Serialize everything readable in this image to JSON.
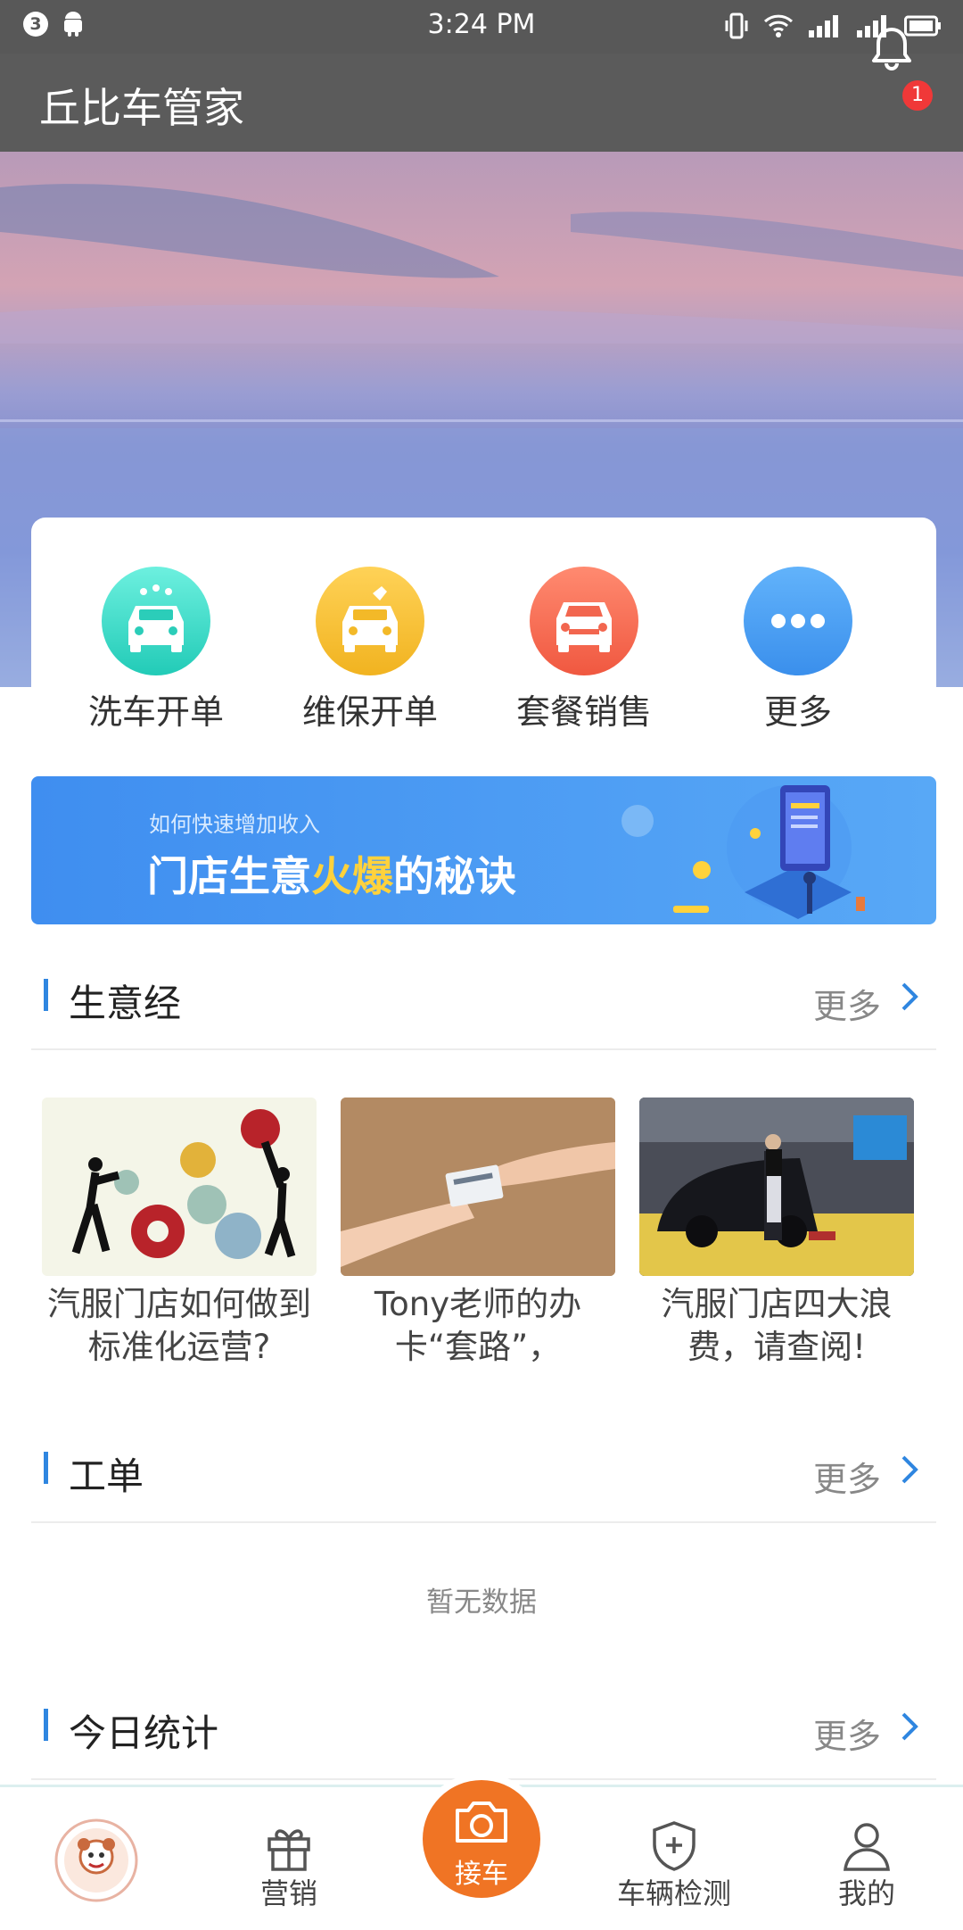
{
  "status_bar": {
    "time": "3:24 PM",
    "notif_count": "3"
  },
  "app_bar": {
    "title": "丘比车管家",
    "bell_badge": "1"
  },
  "quick_actions": [
    {
      "label": "洗车开单",
      "icon": "car-wash-icon",
      "color": "#2ed3c0"
    },
    {
      "label": "维保开单",
      "icon": "car-repair-icon",
      "color": "#f6c030"
    },
    {
      "label": "套餐销售",
      "icon": "car-package-icon",
      "color": "#f46a55"
    },
    {
      "label": "更多",
      "icon": "more-icon",
      "color": "#3f9cf0"
    }
  ],
  "promo": {
    "subtitle": "如何快速增加收入",
    "title_pre": "门店生意",
    "title_hot": "火爆",
    "title_post": "的秘诀"
  },
  "sections": {
    "business": {
      "title": "生意经",
      "more": "更多"
    },
    "orders": {
      "title": "工单",
      "more": "更多",
      "empty_text": "暂无数据"
    },
    "stats": {
      "title": "今日统计",
      "more": "更多"
    }
  },
  "articles": [
    {
      "title": "汽服门店如何做到标准化运营?"
    },
    {
      "title": "Tony老师的办卡“套路”，"
    },
    {
      "title": "汽服门店四大浪费，请查阅!"
    }
  ],
  "tab_bar": {
    "items": [
      {
        "label": "",
        "icon": "store-avatar-icon"
      },
      {
        "label": "营销",
        "icon": "gift-icon"
      },
      {
        "label": "接车",
        "icon": "camera-icon"
      },
      {
        "label": "车辆检测",
        "icon": "shield-plus-icon"
      },
      {
        "label": "我的",
        "icon": "person-icon"
      }
    ]
  },
  "colors": {
    "accent": "#2f86e0",
    "camera": "#f07424",
    "header": "#5b5b5b"
  }
}
